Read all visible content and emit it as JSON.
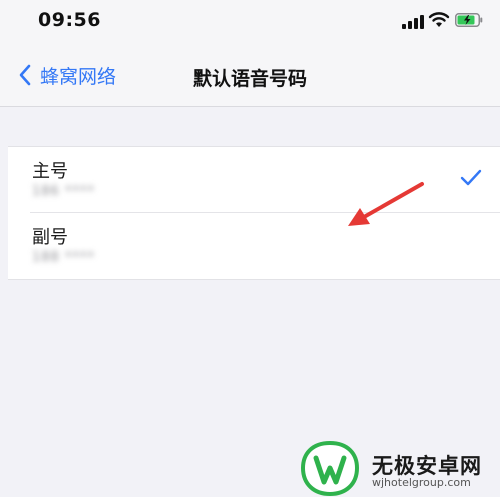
{
  "status_bar": {
    "time": "09:56"
  },
  "nav": {
    "back_label": "蜂窝网络",
    "title": "默认语音号码"
  },
  "options": [
    {
      "label": "主号",
      "number": "186 ****",
      "selected": true
    },
    {
      "label": "副号",
      "number": "188 ****",
      "selected": false
    }
  ],
  "colors": {
    "accent": "#3478f6",
    "annotation_arrow": "#e53935",
    "watermark_green": "#2fb24c"
  },
  "watermark": {
    "title": "无极安卓网",
    "url": "wjhotelgroup.com"
  },
  "icons": {
    "signal": "cellular-signal-icon",
    "wifi": "wifi-icon",
    "battery": "battery-charging-icon",
    "back": "chevron-left-icon",
    "check": "checkmark-icon"
  }
}
